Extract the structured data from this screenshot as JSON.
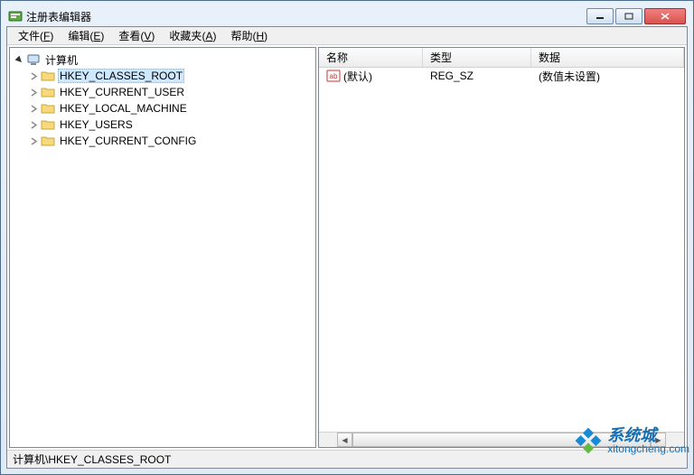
{
  "window": {
    "title": "注册表编辑器"
  },
  "menu": {
    "file": {
      "label": "文件",
      "mn": "F"
    },
    "edit": {
      "label": "编辑",
      "mn": "E"
    },
    "view": {
      "label": "查看",
      "mn": "V"
    },
    "fav": {
      "label": "收藏夹",
      "mn": "A"
    },
    "help": {
      "label": "帮助",
      "mn": "H"
    }
  },
  "tree": {
    "root": "计算机",
    "items": [
      "HKEY_CLASSES_ROOT",
      "HKEY_CURRENT_USER",
      "HKEY_LOCAL_MACHINE",
      "HKEY_USERS",
      "HKEY_CURRENT_CONFIG"
    ],
    "selected_index": 0
  },
  "columns": {
    "name": "名称",
    "type": "类型",
    "data": "数据"
  },
  "rows": [
    {
      "name": "(默认)",
      "type": "REG_SZ",
      "data": "(数值未设置)"
    }
  ],
  "statusbar": "计算机\\HKEY_CLASSES_ROOT",
  "watermark": {
    "cn": "系统城",
    "url": "xitongcheng.com"
  }
}
